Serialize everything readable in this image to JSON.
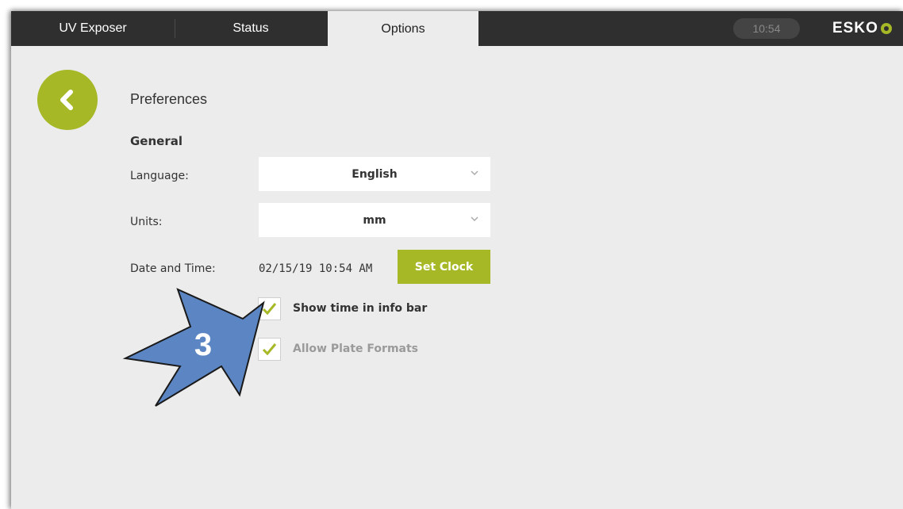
{
  "tabs": {
    "uv_exposer": "UV Exposer",
    "status": "Status",
    "options": "Options"
  },
  "infobar": {
    "time": "10:54",
    "brand": "ESKO"
  },
  "page": {
    "title": "Preferences",
    "section": "General"
  },
  "fields": {
    "language_label": "Language:",
    "language_value": "English",
    "units_label": "Units:",
    "units_value": "mm",
    "datetime_label": "Date and Time:",
    "datetime_value": "02/15/19 10:54 AM",
    "set_clock": "Set Clock"
  },
  "checkboxes": {
    "show_time": {
      "label": "Show time in info bar",
      "checked": true,
      "enabled": true
    },
    "allow_plate": {
      "label": "Allow Plate Formats",
      "checked": true,
      "enabled": false
    }
  },
  "callout": {
    "number": "3"
  },
  "colors": {
    "accent": "#a6b826",
    "topbar": "#2f2f2f",
    "background": "#ececec",
    "callout_arrow": "#5b86c3"
  },
  "icons": {
    "back": "chevron-left-icon",
    "dropdown": "chevron-down-icon",
    "check": "check-icon",
    "logo": "esko-gear-icon"
  }
}
